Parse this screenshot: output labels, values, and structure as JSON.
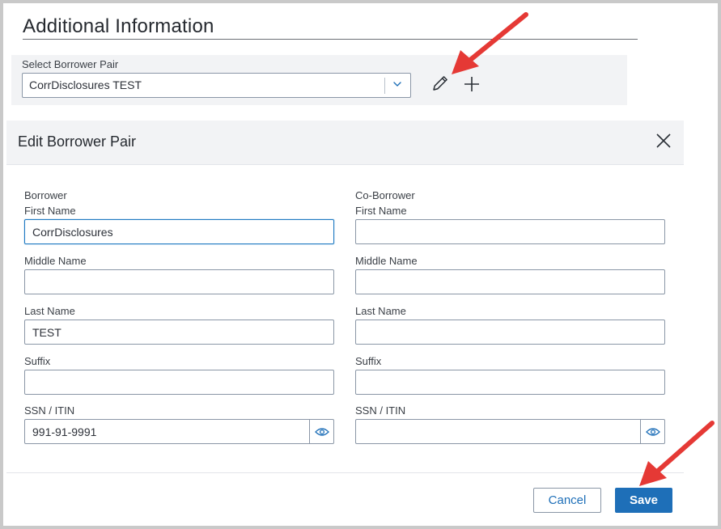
{
  "page": {
    "title": "Additional Information"
  },
  "selector": {
    "label": "Select Borrower Pair",
    "value": "CorrDisclosures TEST",
    "edit_icon": "pencil-icon",
    "add_icon": "plus-icon",
    "chevron_icon": "chevron-down-icon"
  },
  "dialog": {
    "title": "Edit Borrower Pair",
    "close_icon": "close-icon",
    "borrower": {
      "heading": "Borrower",
      "first_name_label": "First Name",
      "first_name_value": "CorrDisclosures",
      "middle_name_label": "Middle Name",
      "middle_name_value": "",
      "last_name_label": "Last Name",
      "last_name_value": "TEST",
      "suffix_label": "Suffix",
      "suffix_value": "",
      "ssn_label": "SSN / ITIN",
      "ssn_value": "991-91-9991"
    },
    "co_borrower": {
      "heading": "Co-Borrower",
      "first_name_label": "First Name",
      "first_name_value": "",
      "middle_name_label": "Middle Name",
      "middle_name_value": "",
      "last_name_label": "Last Name",
      "last_name_value": "",
      "suffix_label": "Suffix",
      "suffix_value": "",
      "ssn_label": "SSN / ITIN",
      "ssn_value": ""
    },
    "cancel_label": "Cancel",
    "save_label": "Save"
  },
  "colors": {
    "primary": "#1e6fb8",
    "panel_bg": "#f2f3f5",
    "annotation_arrow": "#e53935"
  }
}
